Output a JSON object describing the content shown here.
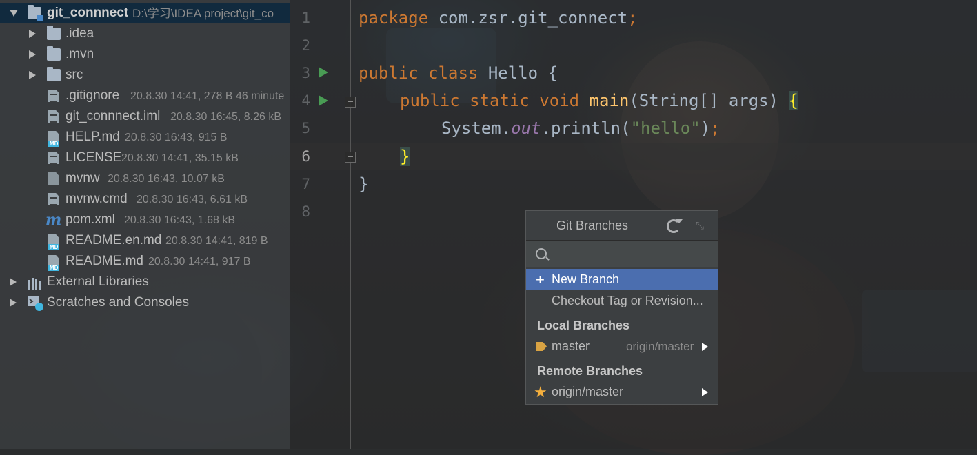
{
  "project": {
    "root_name": "git_connnect",
    "root_path": "D:\\学习\\IDEA project\\git_co",
    "folders": [
      {
        "name": ".idea"
      },
      {
        "name": ".mvn"
      },
      {
        "name": "src"
      }
    ],
    "files": [
      {
        "name": ".gitignore",
        "meta": "20.8.30 14:41, 278 B 46 minute",
        "icon": "gitignore-file-icon"
      },
      {
        "name": "git_connnect.iml",
        "meta": "20.8.30 16:45, 8.26 kB",
        "icon": "iml-file-icon"
      },
      {
        "name": "HELP.md",
        "meta": "20.8.30 16:43, 915 B",
        "icon": "markdown-file-icon"
      },
      {
        "name": "LICENSE",
        "meta": "20.8.30 14:41, 35.15 kB",
        "icon": "text-file-icon"
      },
      {
        "name": "mvnw",
        "meta": "20.8.30 16:43, 10.07 kB",
        "icon": "shell-script-icon"
      },
      {
        "name": "mvnw.cmd",
        "meta": "20.8.30 16:43, 6.61 kB",
        "icon": "text-file-icon"
      },
      {
        "name": "pom.xml",
        "meta": "20.8.30 16:43, 1.68 kB",
        "icon": "maven-icon"
      },
      {
        "name": "README.en.md",
        "meta": "20.8.30 14:41, 819 B",
        "icon": "markdown-file-icon"
      },
      {
        "name": "README.md",
        "meta": "20.8.30 14:41, 917 B",
        "icon": "markdown-file-icon"
      }
    ],
    "external_libraries": "External Libraries",
    "scratches": "Scratches and Consoles",
    "md_badge": "MD",
    "maven_glyph": "m"
  },
  "editor": {
    "line_numbers": [
      "1",
      "2",
      "3",
      "4",
      "5",
      "6",
      "7",
      "8"
    ],
    "current_line": "6",
    "code": {
      "l1_kw": "package",
      "l1_rest": " com.zsr.git_connect",
      "l1_semi": ";",
      "l3_kw": "public class",
      "l3_rest": " Hello {",
      "l4_kw": "public static void",
      "l4_fn": " main",
      "l4_rest": "(String[] args) ",
      "l4_brace": "{",
      "l5_a": "System.",
      "l5_field": "out",
      "l5_b": ".println(",
      "l5_str": "\"hello\"",
      "l5_c": ")",
      "l5_semi": ";",
      "l6_brace": "}",
      "l7": "}"
    }
  },
  "git_popup": {
    "title": "Git Branches",
    "search_value": "",
    "search_placeholder": "",
    "new_branch": "New Branch",
    "checkout_tag": "Checkout Tag or Revision...",
    "local_header": "Local Branches",
    "local_branch": "master",
    "local_tracking": "origin/master",
    "remote_header": "Remote Branches",
    "remote_branch": "origin/master",
    "plus_glyph": "+",
    "star_glyph": "★",
    "collapse_glyph": "⤡"
  },
  "colors": {
    "keyword": "#cc7832",
    "function": "#ffc66d",
    "string": "#6a8759",
    "field": "#9876aa",
    "selection": "#4b6eaf",
    "run_icon": "#499c54"
  }
}
